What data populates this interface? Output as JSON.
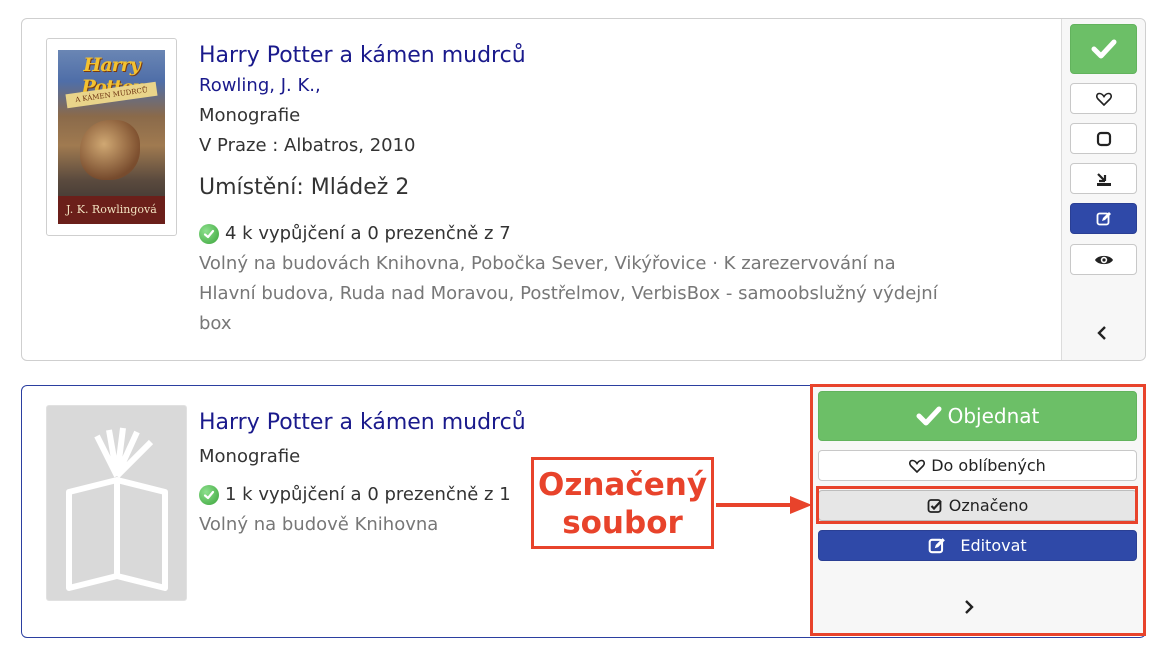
{
  "records": [
    {
      "title": "Harry Potter a kámen mudrců",
      "author": "Rowling, J. K.,",
      "type": "Monografie",
      "publication": "V Praze : Albatros, 2010",
      "location": "Umístění: Mládež 2",
      "availability": "4 k vypůjčení a 0 prezenčně z 7",
      "branches": "Volný na budovách Knihovna, Pobočka Sever, Vikýřovice · K zarezervování na Hlavní budova, Ruda nad Moravou, Postřelmov, VerbisBox - samoobslužný výdejní box",
      "cover": {
        "title_text": "Harry Potter",
        "band_text": "A KÁMEN MUDRCŮ",
        "author_text": "J. K. Rowlingová"
      },
      "actions": [
        {
          "name": "order",
          "icon": "check-icon"
        },
        {
          "name": "favorite",
          "icon": "heart-icon"
        },
        {
          "name": "mark",
          "icon": "checkbox-empty-icon"
        },
        {
          "name": "reserve",
          "icon": "download-icon"
        },
        {
          "name": "edit",
          "icon": "edit-icon"
        },
        {
          "name": "preview",
          "icon": "eye-icon"
        }
      ],
      "toggle_icon": "chevron-left-icon"
    },
    {
      "title": "Harry Potter a kámen mudrců",
      "type": "Monografie",
      "availability": "1 k vypůjčení a 0 prezenčně z 1",
      "branches": "Volný na budově Knihovna",
      "actions": {
        "order_label": "Objednat",
        "favorite_label": "Do oblíbených",
        "marked_label": "Označeno",
        "edit_label": "Editovat"
      },
      "toggle_icon": "chevron-right-icon"
    }
  ],
  "annotation": {
    "label_line1": "Označený",
    "label_line2": "soubor",
    "color": "#e8432b"
  },
  "colors": {
    "link": "#1a1a8c",
    "green_button": "#6cbf67",
    "blue_button": "#2f49a8",
    "muted_text": "#777777",
    "card2_border": "#2b3fa0"
  }
}
